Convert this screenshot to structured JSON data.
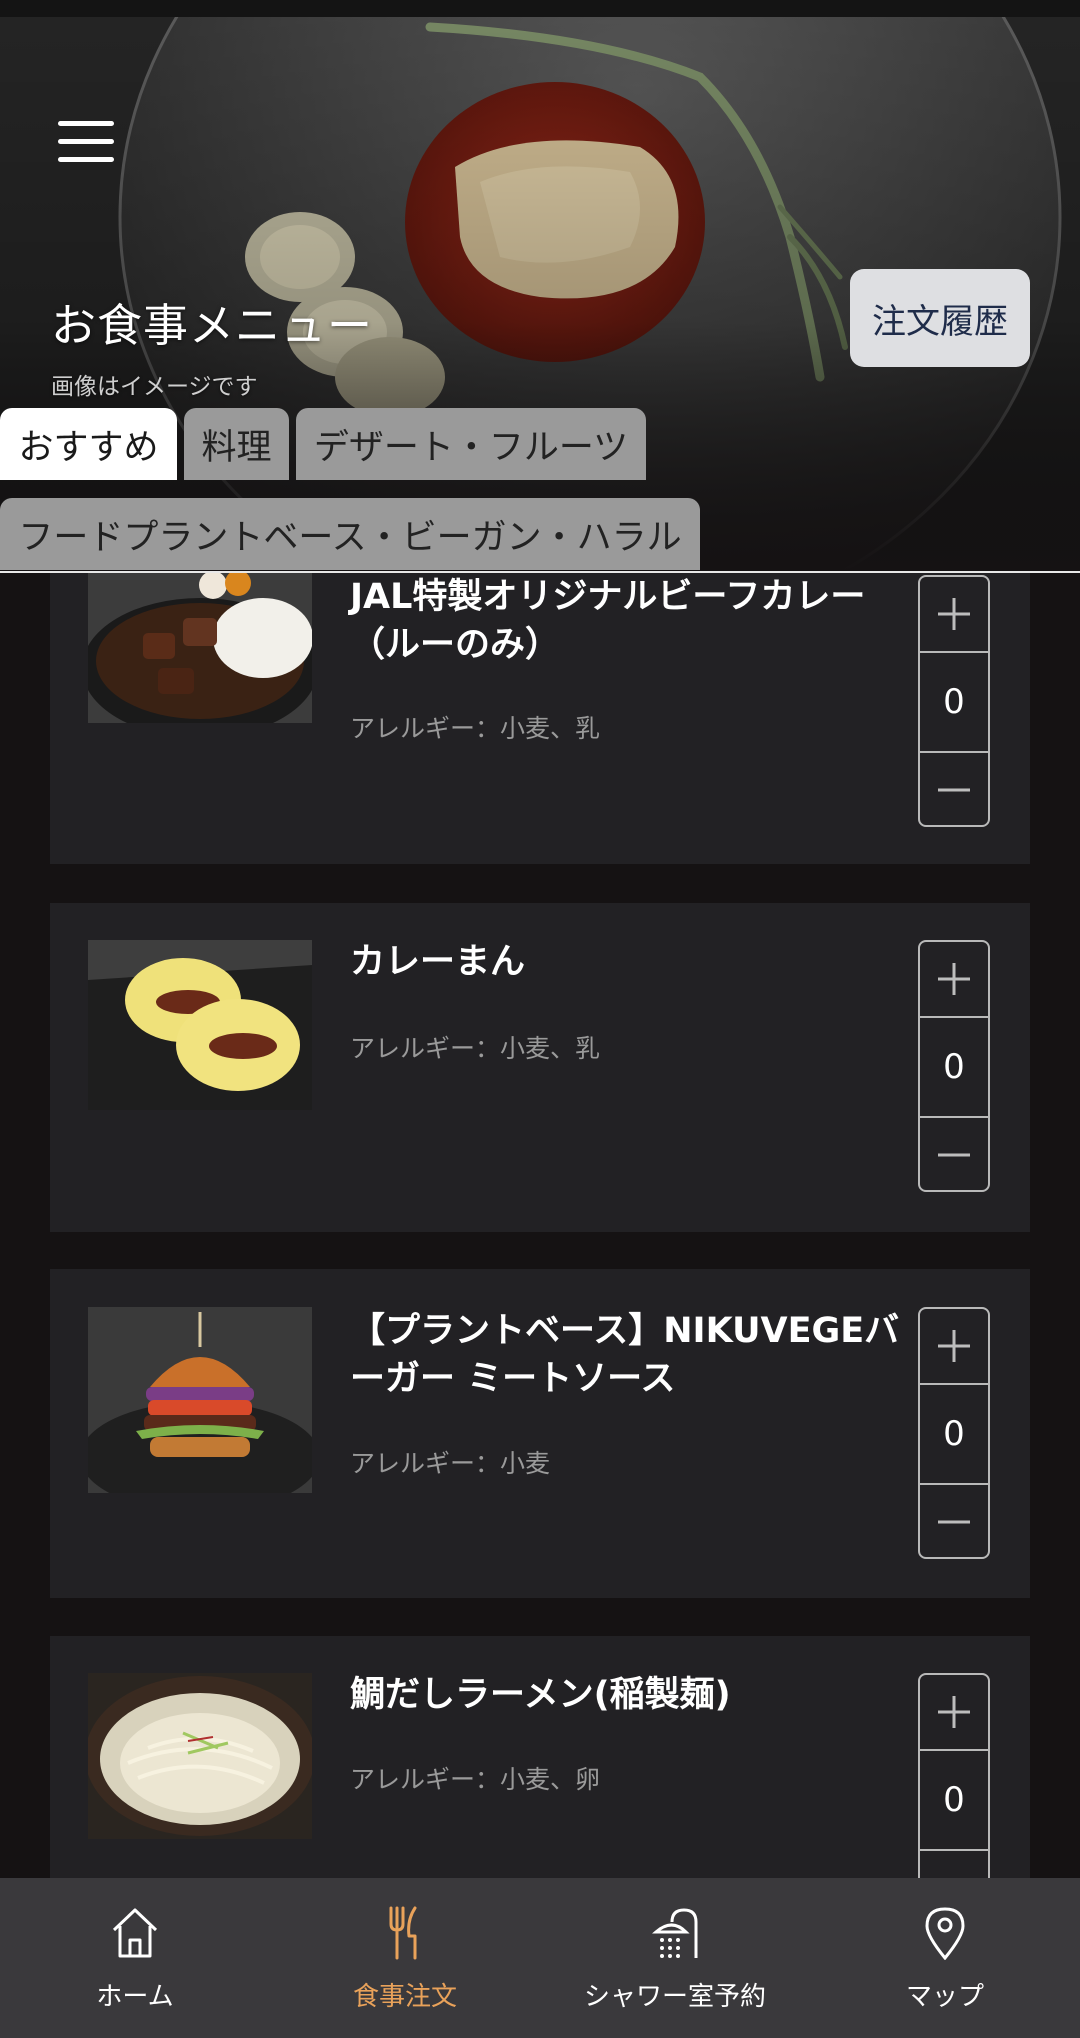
{
  "header": {
    "menu_icon": "hamburger-menu-icon",
    "title": "お食事メニュー",
    "note": "画像はイメージです",
    "history_button": "注文履歴"
  },
  "tabs": [
    {
      "label": "おすすめ",
      "active": true
    },
    {
      "label": "料理",
      "active": false
    },
    {
      "label": "デザート・フルーツ",
      "active": false
    },
    {
      "label": "フードプラントベース・ビーガン・ハラル",
      "active": false
    }
  ],
  "menu_items": [
    {
      "name_line1": "JAL特製オリジナルビーフカレー",
      "name_line2": "（ルーのみ）",
      "allergy": "アレルギー：小麦、乳",
      "quantity": "0"
    },
    {
      "name_line1": "カレーまん",
      "name_line2": "",
      "allergy": "アレルギー：小麦、乳",
      "quantity": "0"
    },
    {
      "name_line1": "【プラントベース】NIKUVEGEバ",
      "name_line2": "ーガー ミートソース",
      "allergy": "アレルギー：小麦",
      "quantity": "0"
    },
    {
      "name_line1": "鯛だしラーメン(稲製麺)",
      "name_line2": "",
      "allergy": "アレルギー：小麦、卵",
      "quantity": "0"
    }
  ],
  "stepper": {
    "plus_icon": "plus-icon",
    "minus_icon": "minus-icon"
  },
  "bottom_nav": [
    {
      "label": "ホーム",
      "icon": "home-icon",
      "active": false
    },
    {
      "label": "食事注文",
      "icon": "fork-knife-icon",
      "active": true
    },
    {
      "label": "シャワー室予約",
      "icon": "shower-icon",
      "active": false
    },
    {
      "label": "マップ",
      "icon": "map-pin-icon",
      "active": false
    }
  ],
  "colors": {
    "background": "#151213",
    "card": "#222124",
    "accent_active_nav": "#e9a25a",
    "nav_bar": "#3a393c",
    "history_button_bg": "#dedfe2"
  }
}
